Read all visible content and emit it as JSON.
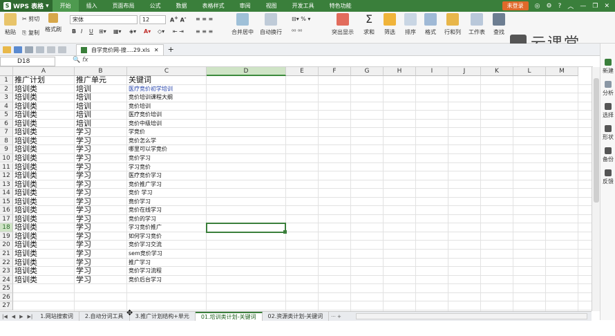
{
  "app": {
    "name": "WPS 表格",
    "login": "未登录"
  },
  "menu": [
    "开始",
    "插入",
    "页面布局",
    "公式",
    "数据",
    "表格样式",
    "审阅",
    "视图",
    "开发工具",
    "特色功能"
  ],
  "ribbon": {
    "paste": "粘贴",
    "cut": "剪切",
    "copy": "复制",
    "format_painter": "格式刷",
    "font_name": "宋体",
    "font_size": "12",
    "merge_center": "合并居中",
    "wrap_text": "自动换行",
    "highlight": "突出显示",
    "sum": "求和",
    "filter": "筛选",
    "sort": "排序",
    "format": "格式",
    "rows_cols": "行和列",
    "worksheet": "工作表",
    "find": "查找"
  },
  "brand": "云课堂",
  "file_tab": "自学竞价网-搜....29.xls",
  "name_box": "D18",
  "fx_label": "fx",
  "columns": [
    "A",
    "B",
    "C",
    "D",
    "E",
    "F",
    "G",
    "H",
    "I",
    "J",
    "K",
    "L",
    "M"
  ],
  "rows": [
    [
      "推广计划",
      "推广单元",
      "关键词"
    ],
    [
      "培训类",
      "培训",
      "医疗竞价初学培训"
    ],
    [
      "培训类",
      "培训",
      "竞价培训课程大纲"
    ],
    [
      "培训类",
      "培训",
      "竞价培训"
    ],
    [
      "培训类",
      "培训",
      "医疗竞价培训"
    ],
    [
      "培训类",
      "培训",
      "竞价中级培训"
    ],
    [
      "培训类",
      "学习",
      "学竞价"
    ],
    [
      "培训类",
      "学习",
      "竞价怎么学"
    ],
    [
      "培训类",
      "学习",
      "哪里可以学竞价"
    ],
    [
      "培训类",
      "学习",
      "竞价学习"
    ],
    [
      "培训类",
      "学习",
      "学习竞价"
    ],
    [
      "培训类",
      "学习",
      "医疗竞价学习"
    ],
    [
      "培训类",
      "学习",
      "竞价推广学习"
    ],
    [
      "培训类",
      "学习",
      "竞价 学习"
    ],
    [
      "培训类",
      "学习",
      "竟价学习"
    ],
    [
      "培训类",
      "学习",
      "竞价在线学习"
    ],
    [
      "培训类",
      "学习",
      "竞价的学习"
    ],
    [
      "培训类",
      "学习",
      "学习竞价推广"
    ],
    [
      "培训类",
      "学习",
      "如何学习竞价"
    ],
    [
      "培训类",
      "学习",
      "竞价学习交流"
    ],
    [
      "培训类",
      "学习",
      "sem竞价学习"
    ],
    [
      "培训类",
      "学习",
      "推广学习"
    ],
    [
      "培训类",
      "学习",
      "竞价学习流程"
    ],
    [
      "培训类",
      "学习",
      "竞价后台学习"
    ]
  ],
  "row_count": 27,
  "selected_row": 18,
  "selected_col": "D",
  "side_panel": [
    "新建",
    "分析",
    "选择",
    "形状",
    "备份",
    "反馈"
  ],
  "sheets": [
    "1.网站搜索词",
    "2.自动分词工具",
    "3.推广计划结构+单元",
    "01.培训类计划-关键词",
    "02.资源类计划-关键词"
  ],
  "active_sheet": 3,
  "colors": {
    "accent": "#3a7f3b",
    "link_text": "#1f3ea8"
  }
}
